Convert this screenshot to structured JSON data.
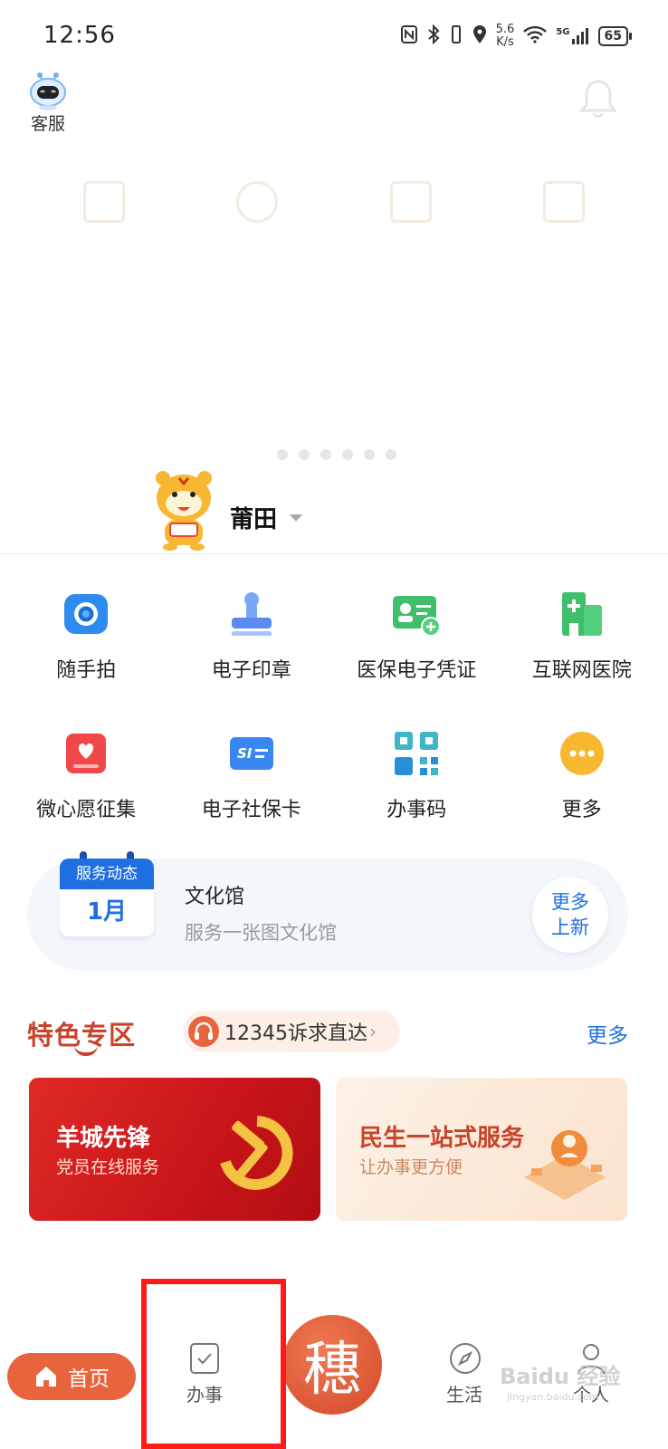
{
  "status_bar": {
    "time": "12:56",
    "speed_value": "5.6",
    "speed_unit": "K/s",
    "network": "5G",
    "battery": "65"
  },
  "header": {
    "kefu_label": "客服"
  },
  "carousel": {
    "page_count": 6
  },
  "city": {
    "name": "莆田"
  },
  "services": [
    {
      "label": "随手拍",
      "icon": "camera-icon"
    },
    {
      "label": "电子印章",
      "icon": "stamp-icon"
    },
    {
      "label": "医保电子凭证",
      "icon": "insurance-card-icon"
    },
    {
      "label": "互联网医院",
      "icon": "hospital-icon"
    },
    {
      "label": "微心愿征集",
      "icon": "wish-icon"
    },
    {
      "label": "电子社保卡",
      "icon": "social-security-card-icon"
    },
    {
      "label": "办事码",
      "icon": "qr-code-icon"
    },
    {
      "label": "更多",
      "icon": "more-icon"
    }
  ],
  "news": {
    "calendar_header": "服务动态",
    "calendar_month": "1月",
    "title": "文化馆",
    "subtitle": "服务一张图文化馆",
    "more_line1": "更多",
    "more_line2": "上新"
  },
  "featured": {
    "title": "特色专区",
    "hotline": "12345诉求直达",
    "more": "更多",
    "banners": [
      {
        "title": "羊城先锋",
        "subtitle": "党员在线服务"
      },
      {
        "title": "民生一站式服务",
        "subtitle": "让办事更方便"
      }
    ]
  },
  "nav": {
    "home": "首页",
    "affairs": "办事",
    "center_glyph": "穗",
    "life": "生活",
    "personal": "个人"
  },
  "watermark": {
    "brand": "Baidu 经验",
    "url": "jingyan.baidu.com"
  },
  "colors": {
    "accent_orange": "#e8643c",
    "brand_blue": "#1f6fe0",
    "featured_red": "#c8432a",
    "highlight_red": "#ff1a1a"
  }
}
